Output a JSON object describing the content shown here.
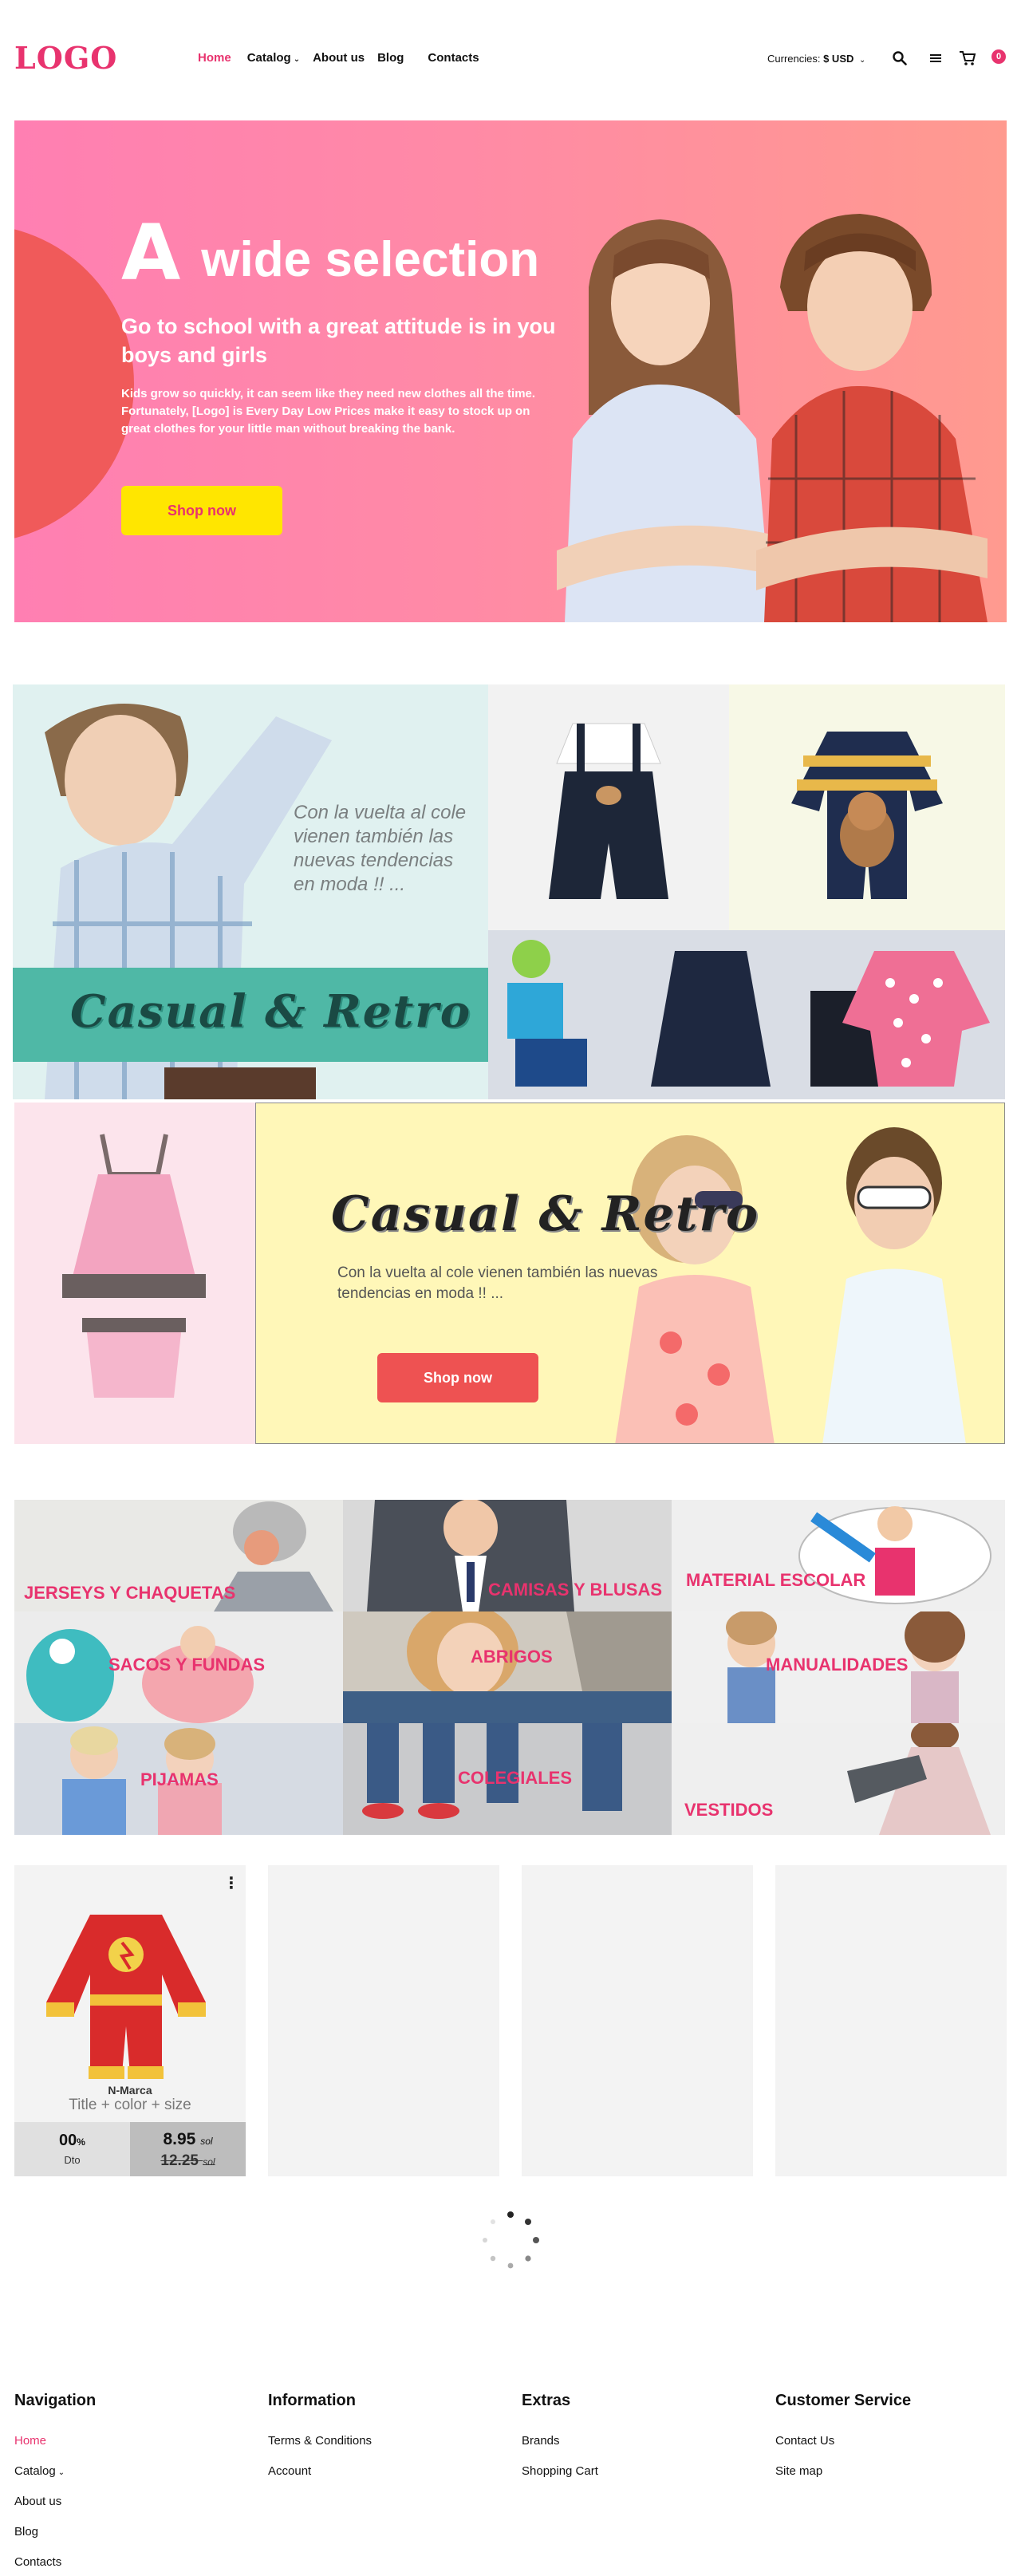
{
  "header": {
    "logo": "LOGO",
    "nav": [
      "Home",
      "Catalog",
      "About us",
      "Blog",
      "Contacts"
    ],
    "currency_label": "Currencies:",
    "currency_value": "$ USD",
    "cart_count": "0",
    "accent": "#e8336e"
  },
  "hero": {
    "title_letter": "A",
    "title_rest": "wide  selection",
    "subtitle": "Go to school with a great attitude is in you boys and girls",
    "body": "Kids grow so quickly, it can seem like they need new clothes all the time. Fortunately, [Logo] is Every Day Low Prices make it easy  to stock up on great clothes for your little man without breaking the bank.",
    "button": "Shop now"
  },
  "promo": {
    "quote": "Con la vuelta al cole vienen también las nuevas tendencias en moda !! ...",
    "script_title": "Casual & Retro"
  },
  "banner2": {
    "script_title": "Casual & Retro",
    "text": "Con la vuelta al cole vienen también las nuevas tendencias en moda !! ...",
    "button": "Shop now"
  },
  "categories": [
    "JERSEYS Y CHAQUETAS",
    "CAMISAS Y BLUSAS",
    "MATERIAL ESCOLAR",
    "SACOS Y FUNDAS",
    "ABRIGOS",
    "MANUALIDADES",
    "PIJAMAS",
    "COLEGIALES",
    "VESTIDOS"
  ],
  "product": {
    "menu": "⋮",
    "brand": "N-Marca",
    "title": "Title + color + size",
    "discount": "00",
    "discount_unit": "%",
    "dto_label": "Dto",
    "price": "8.95",
    "price_unit": "sol",
    "old_price": "12.25",
    "old_unit": "sol"
  },
  "footer": {
    "navigation": {
      "heading": "Navigation",
      "links": [
        "Home",
        "Catalog",
        "About us",
        "Blog",
        "Contacts"
      ]
    },
    "information": {
      "heading": "Information",
      "links": [
        "Terms & Conditions",
        "Account"
      ]
    },
    "extras": {
      "heading": "Extras",
      "links": [
        "Brands",
        "Shopping Cart"
      ]
    },
    "service": {
      "heading": "Customer Service",
      "links": [
        "Contact Us",
        "Site map"
      ]
    }
  }
}
